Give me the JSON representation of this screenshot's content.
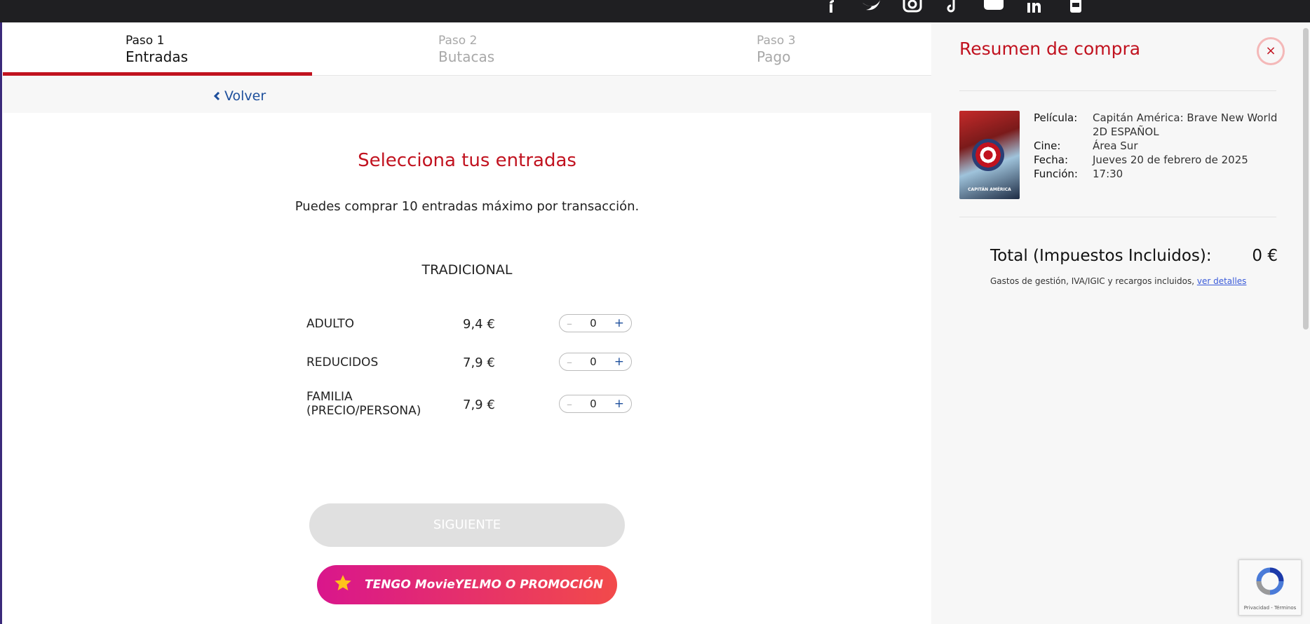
{
  "header": {
    "social_icons": [
      "facebook-icon",
      "twitter-icon",
      "instagram-icon",
      "tiktok-icon",
      "youtube-icon",
      "linkedin-icon",
      "mobile-app-icon"
    ]
  },
  "steps": [
    {
      "small": "Paso 1",
      "big": "Entradas",
      "state": "active"
    },
    {
      "small": "Paso 2",
      "big": "Butacas",
      "state": "inactive"
    },
    {
      "small": "Paso 3",
      "big": "Pago",
      "state": "inactive"
    }
  ],
  "back": {
    "label": "Volver"
  },
  "main": {
    "title": "Selecciona tus entradas",
    "max_note": "Puedes comprar 10 entradas máximo por transacción.",
    "section": "TRADICIONAL",
    "tickets": [
      {
        "name": "ADULTO",
        "price": "9,4 €",
        "qty": "0"
      },
      {
        "name": "REDUCIDOS",
        "price": "7,9 €",
        "qty": "0"
      },
      {
        "name": "FAMILIA\n(PRECIO/PERSONA)",
        "name_line1": "FAMILIA",
        "name_line2": "(PRECIO/PERSONA)",
        "price": "7,9 €",
        "qty": "0"
      }
    ],
    "stepper_minus": "–",
    "stepper_plus": "+",
    "next_button": "SIGUIENTE",
    "promo_button": "TENGO MovieYELMO O PROMOCIÓN"
  },
  "sidebar": {
    "title": "Resumen de compra",
    "close": "×",
    "poster_text": "CAPITÁN AMÉRICA",
    "movie_label": "Película:",
    "movie_value": "Capitán América: Brave New World 2D ESPAÑOL",
    "cinema_label": "Cine:",
    "cinema_value": "Área Sur",
    "date_label": "Fecha:",
    "date_value": "Jueves 20 de febrero de 2025",
    "show_label": "Función:",
    "show_value": "17:30",
    "total_label": "Total (Impuestos Incluidos):",
    "total_value": "0 €",
    "fees_text": "Gastos de gestión, IVA/IGIC y recargos incluidos,",
    "fees_link": "ver detalles"
  },
  "recaptcha": {
    "text": "Privacidad - Términos"
  },
  "colors": {
    "accent": "#c1121f",
    "link": "#1d4f9c",
    "promo_start": "#d9168c",
    "promo_end": "#f24a4a"
  }
}
